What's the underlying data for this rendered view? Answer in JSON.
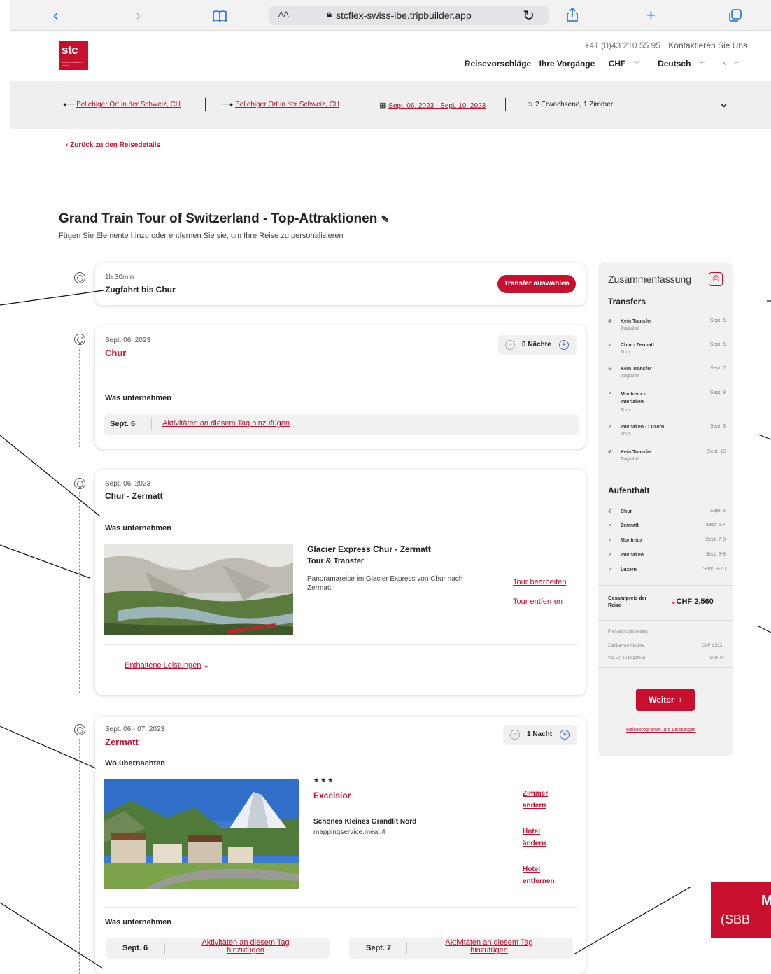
{
  "browser": {
    "text_size": "AA",
    "url": "stcflex-swiss-ibe.tripbuilder.app"
  },
  "header": {
    "logo_text": "stc",
    "logo_sub": "switzerland travel centre",
    "phone": "+41 (0)43 210 55 95",
    "contact": "Kontaktieren Sie Uns",
    "nav": {
      "suggestions": "Reisevorschläge",
      "bookings": "Ihre Vorgänge",
      "currency": "CHF",
      "language": "Deutsch",
      "account": "A"
    }
  },
  "search": {
    "from": "Beliebiger Ort in der Schweiz, CH",
    "to": "Beliebiger Ort in der Schweiz, CH",
    "dates": "Sept. 06, 2023 - Sept. 10, 2023",
    "guests": "2 Erwachsene, 1 Zimmer"
  },
  "back_link": "‹ Zurück zu den Reisedetails",
  "page": {
    "title": "Grand Train Tour of Switzerland - Top-Attraktionen",
    "subtitle": "Fügen Sie Elemente hinzu oder entfernen Sie sie, um Ihre Reise zu personalisieren"
  },
  "transfer_card": {
    "duration": "1h 30min",
    "title": "Zugfahrt bis Chur",
    "button": "Transfer auswählen"
  },
  "chur_card": {
    "date": "Sept. 06, 2023",
    "city": "Chur",
    "nights": "0 Nächte",
    "section": "Was unternehmen",
    "day": "Sept. 6",
    "add_activity": "Aktivitäten an diesem Tag hinzufügen"
  },
  "tour_card": {
    "date": "Sept. 06, 2023",
    "route": "Chur - Zermatt",
    "section": "Was unternehmen",
    "tour_title": "Glacier Express Chur - Zermatt",
    "tour_type": "Tour & Transfer",
    "description": "Panoramareise im Glacier Express von Chur nach Zermatt",
    "edit": "Tour bearbeiten",
    "remove": "Tour entfernen",
    "included": "Enthaltene Leistungen"
  },
  "zermatt_card": {
    "date": "Sept. 06 - 07, 2023",
    "city": "Zermatt",
    "nights": "1 Nacht",
    "stay_section": "Wo übernachten",
    "stars": "★★★",
    "hotel": "Excelsior",
    "room": "Schönes Kleines Grandlit Nord",
    "meal": "mappingservice.meal.4",
    "change_room": [
      "Zimmer",
      "ändern"
    ],
    "change_hotel": [
      "Hotel",
      "ändern"
    ],
    "remove_hotel": [
      "Hotel",
      "entfernen"
    ],
    "activity_section": "Was unternehmen",
    "days": [
      {
        "day": "Sept. 6",
        "add": [
          "Aktivitäten an diesem Tag",
          "hinzufügen"
        ]
      },
      {
        "day": "Sept. 7",
        "add": [
          "Aktivitäten an diesem Tag",
          "hinzufügen"
        ]
      }
    ]
  },
  "summary": {
    "title": "Zusammenfassung",
    "transfers_label": "Transfers",
    "transfers": [
      {
        "name": "Kein Transfer",
        "sub": "Zugfahrt",
        "date": "Sept. 6",
        "icon": "no-transfer"
      },
      {
        "name": "Chur - Zermatt",
        "sub": "Tour",
        "date": "Sept. 6",
        "icon": "check"
      },
      {
        "name": "Kein Transfer",
        "sub": "Zugfahrt",
        "date": "Sept. 7",
        "icon": "no-transfer"
      },
      {
        "name": "Montreux - Interlaken",
        "sub": "Tour",
        "date": "Sept. 8",
        "icon": "check"
      },
      {
        "name": "Interlaken - Luzern",
        "sub": "Tour",
        "date": "Sept. 9",
        "icon": "check"
      },
      {
        "name": "Kein Transfer",
        "sub": "Zugfahrt",
        "date": "Sept. 10",
        "icon": "no-transfer"
      }
    ],
    "stay_label": "Aufenthalt",
    "stays": [
      {
        "name": "Chur",
        "date": "Sept. 6",
        "icon": "no-hotel"
      },
      {
        "name": "Zermatt",
        "date": "Sept. 6-7",
        "icon": "check"
      },
      {
        "name": "Montreux",
        "date": "Sept. 7-8",
        "icon": "check"
      },
      {
        "name": "Interlaken",
        "date": "Sept. 8-9",
        "icon": "check"
      },
      {
        "name": "Luzern",
        "date": "Sept. 9-10",
        "icon": "check"
      }
    ],
    "total_label": "Gesamtpreis der Reise",
    "total": "CHF 2,560",
    "breakdown_label": "Preisaufschlüsselung",
    "before_label": "Zahlbar vor Abreise",
    "before": "CHF 2,523",
    "onsite_label": "Vor Ort zu bezahlen",
    "onsite": "CHF 37",
    "continue": "Weiter",
    "program_link": "Reiseprogramm und Leistungen"
  },
  "callout": {
    "text": "M",
    "sub": "(SBB"
  },
  "colors": {
    "accent": "#c8102e",
    "safari_blue": "#1a73e8",
    "stepper_blue": "#4a6fb5"
  }
}
